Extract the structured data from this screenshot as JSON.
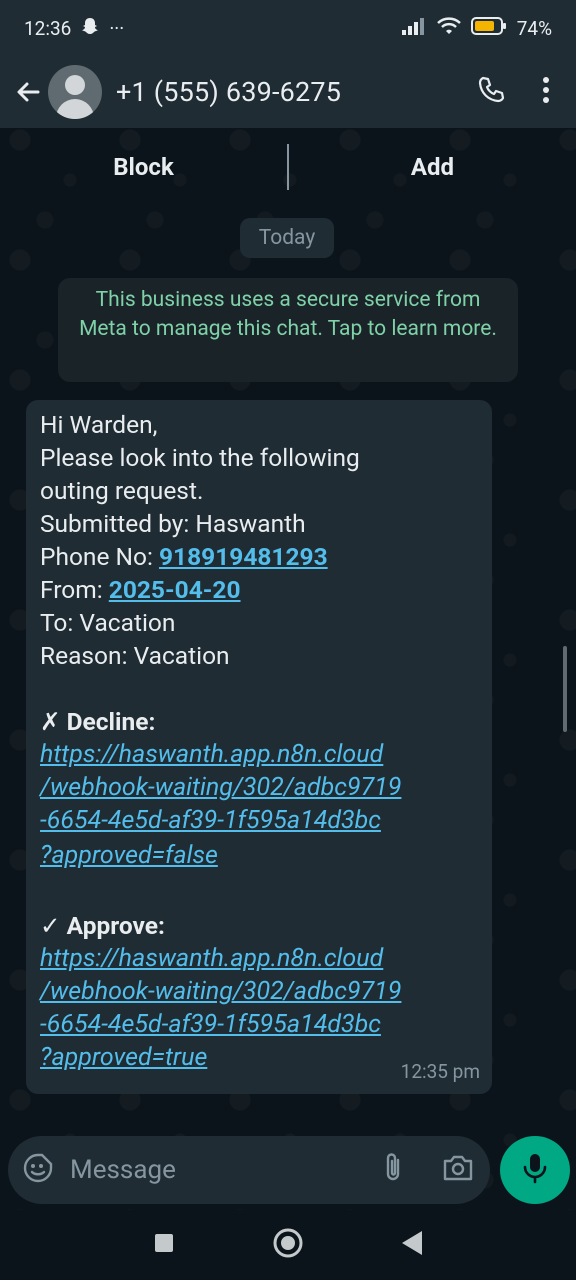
{
  "status_bar": {
    "time": "12:36",
    "more": "···",
    "battery_percent": "74%"
  },
  "header": {
    "contact": "+1 (555) 639-6275"
  },
  "action_bar": {
    "block": "Block",
    "add": "Add"
  },
  "chat": {
    "date_chip": "Today",
    "system_notice": "This business uses a secure service from Meta to manage this chat. Tap to learn more.",
    "message": {
      "greeting": "Hi Warden,",
      "line1": "Please look into the following",
      "line2": "outing request.",
      "submitted_by": "Submitted by: Haswanth",
      "phone_label": "Phone No: ",
      "phone_value": "918919481293",
      "from_label": "From: ",
      "from_value": "2025-04-20",
      "to": "To: Vacation",
      "reason": "Reason: Vacation",
      "decline_heading": "✗ Decline:",
      "decline_link": [
        "https://haswanth.app.n8n.cloud",
        "/webhook-waiting/302/adbc9719",
        "-6654-4e5d-af39-1f595a14d3bc",
        "?approved=false"
      ],
      "approve_heading": "✓ Approve:",
      "approve_link": [
        "https://haswanth.app.n8n.cloud",
        "/webhook-waiting/302/adbc9719",
        "-6654-4e5d-af39-1f595a14d3bc",
        "?approved=true"
      ],
      "time": "12:35 pm"
    }
  },
  "composer": {
    "placeholder": "Message"
  },
  "colors": {
    "background": "#0b141a",
    "bar": "#1f2c34",
    "bubble": "#202c33",
    "link": "#53bdeb",
    "notice_text": "#7fd1a8",
    "accent": "#00a884"
  }
}
